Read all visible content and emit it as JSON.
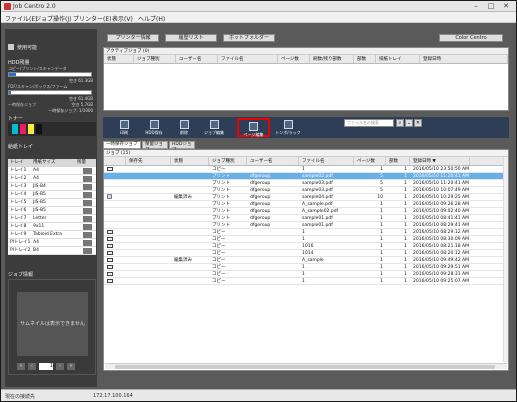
{
  "app": {
    "title": "Job Centro 2.0"
  },
  "menu": [
    "ファイル(E)",
    "ジョブ操作(J)",
    "プリンター(E)",
    "表示(V)",
    "ヘルプ(H)"
  ],
  "left": {
    "status": "使用可能",
    "hdd_label": "HDD残量",
    "copy_scan_label": "コピー/プリント/スキャンデータ",
    "copy_scan_free": "空き 61.3GB",
    "fdf_label": "FDF/スキャン/ボックス/ファーム",
    "fdf_free": "空き 61.4GB",
    "temp_label": "一時保存ジョブ",
    "temp_free": "空き 5.7GB",
    "temp_extra": "一時保存ジョブ: 1/1000",
    "toner_label": "トナー",
    "paper_label": "給紙トレイ",
    "tray_headers": [
      "トレイ",
      "用紙サイズ",
      "残量"
    ],
    "trays": [
      {
        "name": "トレイ1",
        "size": "A4"
      },
      {
        "name": "トレイ2",
        "size": "A4"
      },
      {
        "name": "トレイ3",
        "size": "JIS-B4"
      },
      {
        "name": "トレイ4",
        "size": "JIS-B5"
      },
      {
        "name": "トレイ5",
        "size": "JIS-B5"
      },
      {
        "name": "トレイ6",
        "size": "JIS-B5"
      },
      {
        "name": "トレイ7",
        "size": "Letter"
      },
      {
        "name": "トレイ8",
        "size": "9x11"
      },
      {
        "name": "トレイ9",
        "size": "Tabloid Extra"
      },
      {
        "name": "PIトレイ1",
        "size": "A4"
      },
      {
        "name": "PIトレイ2",
        "size": "B4"
      }
    ],
    "job_info_label": "ジョブ情報",
    "thumb_text": "サムネイルは表示できません",
    "page_value": "1"
  },
  "top_buttons": [
    "プリンター情報",
    "履歴リスト",
    "ホットフォルダー",
    "Color Centro"
  ],
  "active_panel": {
    "caption": "アクティブジョブ (0)",
    "headers": [
      "状態",
      "ジョブ種別",
      "ユーザー名",
      "ファイル名",
      "ページ数",
      "刷数/残り部数",
      "部数",
      "排紙トレイ",
      "登録日時"
    ]
  },
  "toolbar": {
    "buttons": [
      "印刷",
      "HDD保存",
      "削除",
      "ジョブ編集",
      "ページ編集",
      "トンボ/ラック"
    ],
    "search_placeholder": "ファイル名の検索"
  },
  "subtabs": [
    "一時保存ジョブ",
    "保留ジョブ",
    "HDDジョブ"
  ],
  "jobs": {
    "caption": "ジョブ (15)",
    "headers": [
      "",
      "保存先",
      "状態",
      "ジョブ種別",
      "ユーザー名",
      "ファイル名",
      "ページ数",
      "部数",
      "登録日時 ▼"
    ],
    "rows": [
      {
        "icon": "copy",
        "state": "",
        "type": "コピー",
        "user": "",
        "file": "1",
        "pages": "1",
        "copies": "1",
        "date": "2016/05/10 23:50:50 AM",
        "selected": false
      },
      {
        "icon": "",
        "state": "",
        "type": "プリント",
        "user": "dfgeroup",
        "file": "sample02.pdf",
        "pages": "5",
        "copies": "1",
        "date": "2016/05/10 11:20:41 AM",
        "selected": true
      },
      {
        "icon": "",
        "state": "",
        "type": "プリント",
        "user": "dfgeroup",
        "file": "sample03.pdf",
        "pages": "5",
        "copies": "1",
        "date": "2016/05/10 11:20:41 AM",
        "selected": false
      },
      {
        "icon": "",
        "state": "",
        "type": "プリント",
        "user": "dfgeroup",
        "file": "sample03.pdf",
        "pages": "5",
        "copies": "1",
        "date": "2016/05/10 10:07:49 AM",
        "selected": false
      },
      {
        "icon": "edit",
        "state": "編集済み",
        "type": "プリント",
        "user": "dfgeroup",
        "file": "sample04.pdf",
        "pages": "10",
        "copies": "1",
        "date": "2016/05/10 10:29:25 AM",
        "selected": false
      },
      {
        "icon": "",
        "state": "",
        "type": "プリント",
        "user": "dfgeroup",
        "file": "A_sample.pdf",
        "pages": "1",
        "copies": "1",
        "date": "2016/05/10 09:26:28 AM",
        "selected": false
      },
      {
        "icon": "",
        "state": "",
        "type": "プリント",
        "user": "dfgeroup",
        "file": "A_sample02.pdf",
        "pages": "1",
        "copies": "1",
        "date": "2016/05/10 09:02:40 AM",
        "selected": false
      },
      {
        "icon": "",
        "state": "",
        "type": "プリント",
        "user": "dfgeroup",
        "file": "sample01.pdf",
        "pages": "1",
        "copies": "1",
        "date": "2016/05/10 08:41:41 AM",
        "selected": false
      },
      {
        "icon": "",
        "state": "",
        "type": "プリント",
        "user": "dfgeroup",
        "file": "sample01.pdf",
        "pages": "1",
        "copies": "1",
        "date": "2016/05/10 08:29:41 AM",
        "selected": false
      },
      {
        "icon": "copy",
        "state": "",
        "type": "コピー",
        "user": "",
        "file": "1",
        "pages": "1",
        "copies": "1",
        "date": "2016/05/10 08:29:12 AM",
        "selected": false
      },
      {
        "icon": "copy",
        "state": "",
        "type": "コピー",
        "user": "",
        "file": "1",
        "pages": "1",
        "copies": "1",
        "date": "2016/05/10 08:30:09 AM",
        "selected": false
      },
      {
        "icon": "copy",
        "state": "",
        "type": "コピー",
        "user": "",
        "file": "1016",
        "pages": "1",
        "copies": "1",
        "date": "2016/05/10 08:21:18 AM",
        "selected": false
      },
      {
        "icon": "copy",
        "state": "",
        "type": "コピー",
        "user": "",
        "file": "1014",
        "pages": "1",
        "copies": "1",
        "date": "2016/05/10 08:20:12 AM",
        "selected": false
      },
      {
        "icon": "copy",
        "state": "編集済み",
        "type": "コピー",
        "user": "",
        "file": "A_sample",
        "pages": "1",
        "copies": "1",
        "date": "2016/05/10 09:49:42 AM",
        "selected": false
      },
      {
        "icon": "copy",
        "state": "",
        "type": "コピー",
        "user": "",
        "file": "1",
        "pages": "1",
        "copies": "1",
        "date": "2016/05/10 09:29:51 AM",
        "selected": false
      },
      {
        "icon": "copy",
        "state": "",
        "type": "コピー",
        "user": "",
        "file": "1",
        "pages": "1",
        "copies": "1",
        "date": "2016/05/10 09:28:31 AM",
        "selected": false
      },
      {
        "icon": "copy",
        "state": "",
        "type": "コピー",
        "user": "",
        "file": "1",
        "pages": "1",
        "copies": "1",
        "date": "2016/05/10 09:25:07 AM",
        "selected": false
      }
    ]
  },
  "statusbar": {
    "left": "現在の接続先",
    "ip": "172.17.100.164"
  }
}
